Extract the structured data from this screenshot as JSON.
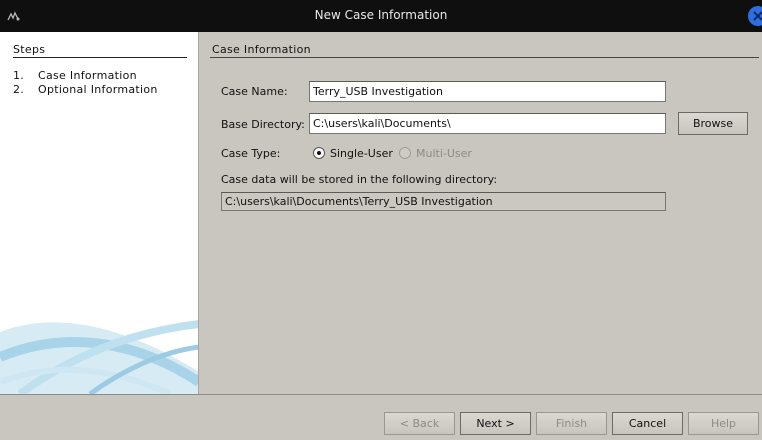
{
  "window": {
    "title": "New Case Information"
  },
  "steps": {
    "heading": "Steps",
    "items": [
      {
        "num": "1.",
        "label": "Case Information"
      },
      {
        "num": "2.",
        "label": "Optional Information"
      }
    ]
  },
  "panel": {
    "heading": "Case Information",
    "case_name": {
      "label": "Case Name:",
      "value": "Terry_USB Investigation"
    },
    "base_directory": {
      "label": "Base Directory:",
      "value": "C:\\users\\kali\\Documents\\",
      "browse_label": "Browse"
    },
    "case_type": {
      "label": "Case Type:",
      "options": [
        "Single-User",
        "Multi-User"
      ],
      "selected": "Single-User"
    },
    "storage": {
      "label": "Case data will be stored in the following directory:",
      "value": "C:\\users\\kali\\Documents\\Terry_USB Investigation"
    }
  },
  "buttons": {
    "back": "< Back",
    "next": "Next >",
    "finish": "Finish",
    "cancel": "Cancel",
    "help": "Help"
  },
  "colors": {
    "titlebar": "#0f0f0f",
    "panel": "#c9c5bf",
    "close": "#2f6fe0"
  }
}
